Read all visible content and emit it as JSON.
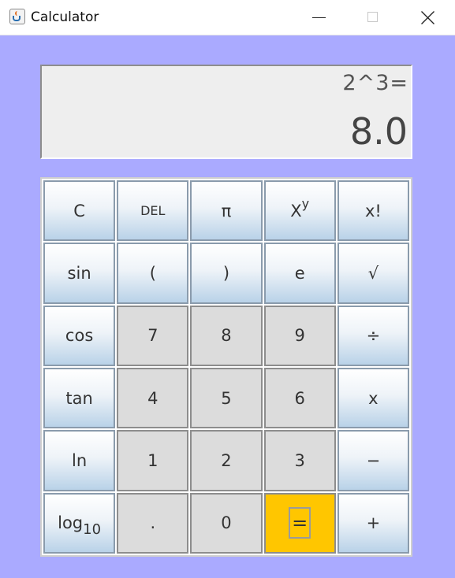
{
  "window": {
    "title": "Calculator",
    "minimize_icon": "minimize-icon",
    "maximize_icon": "maximize-icon",
    "close_icon": "close-icon"
  },
  "display": {
    "expression": "2^3=",
    "result": "8.0"
  },
  "keys": {
    "clear": "C",
    "delete": "DEL",
    "pi": "π",
    "power_base": "X",
    "power_exp": "y",
    "factorial": "x!",
    "sin": "sin",
    "open_paren": "(",
    "close_paren": ")",
    "euler": "e",
    "sqrt": "√",
    "cos": "cos",
    "seven": "7",
    "eight": "8",
    "nine": "9",
    "divide": "÷",
    "tan": "tan",
    "four": "4",
    "five": "5",
    "six": "6",
    "multiply": "x",
    "ln": "ln",
    "one": "1",
    "two": "2",
    "three": "3",
    "minus": "−",
    "log_base": "log",
    "log_sub": "10",
    "dot": ".",
    "zero": "0",
    "equals": "=",
    "plus": "+"
  },
  "colors": {
    "background": "#aaaaff",
    "equals_key": "#ffc600",
    "number_key": "#dcdcdc"
  }
}
